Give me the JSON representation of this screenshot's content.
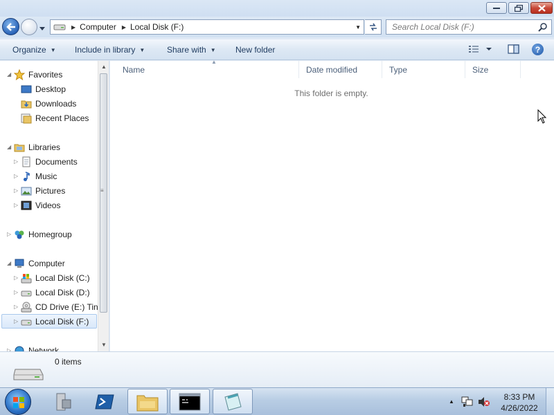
{
  "window": {
    "controls": {
      "minimize": "minimize",
      "maximize": "maximize",
      "close": "close"
    }
  },
  "address": {
    "breadcrumbs": [
      "Computer",
      "Local Disk (F:)"
    ],
    "search_placeholder": "Search Local Disk (F:)"
  },
  "toolbar": {
    "organize": "Organize",
    "include_in_library": "Include in library",
    "share_with": "Share with",
    "new_folder": "New folder"
  },
  "nav": {
    "favorites": {
      "label": "Favorites",
      "items": [
        "Desktop",
        "Downloads",
        "Recent Places"
      ]
    },
    "libraries": {
      "label": "Libraries",
      "items": [
        "Documents",
        "Music",
        "Pictures",
        "Videos"
      ]
    },
    "homegroup": "Homegroup",
    "computer": {
      "label": "Computer",
      "items": [
        "Local Disk (C:)",
        "Local Disk (D:)",
        "CD Drive (E:) Tiny",
        "Local Disk (F:)"
      ]
    },
    "network": "Network",
    "selected": "Local Disk (F:)"
  },
  "columns": [
    "Name",
    "Date modified",
    "Type",
    "Size"
  ],
  "content": {
    "empty_message": "This folder is empty."
  },
  "details": {
    "item_count": "0 items"
  },
  "taskbar": {
    "clock_time": "8:33 PM",
    "clock_date": "4/26/2022",
    "apps": [
      "server-manager",
      "powershell",
      "explorer",
      "command-prompt",
      "notepad"
    ]
  },
  "colors": {
    "accent": "#2a64b8",
    "title_bg": "#dbe7f5",
    "selection": "#d9e8fa"
  }
}
